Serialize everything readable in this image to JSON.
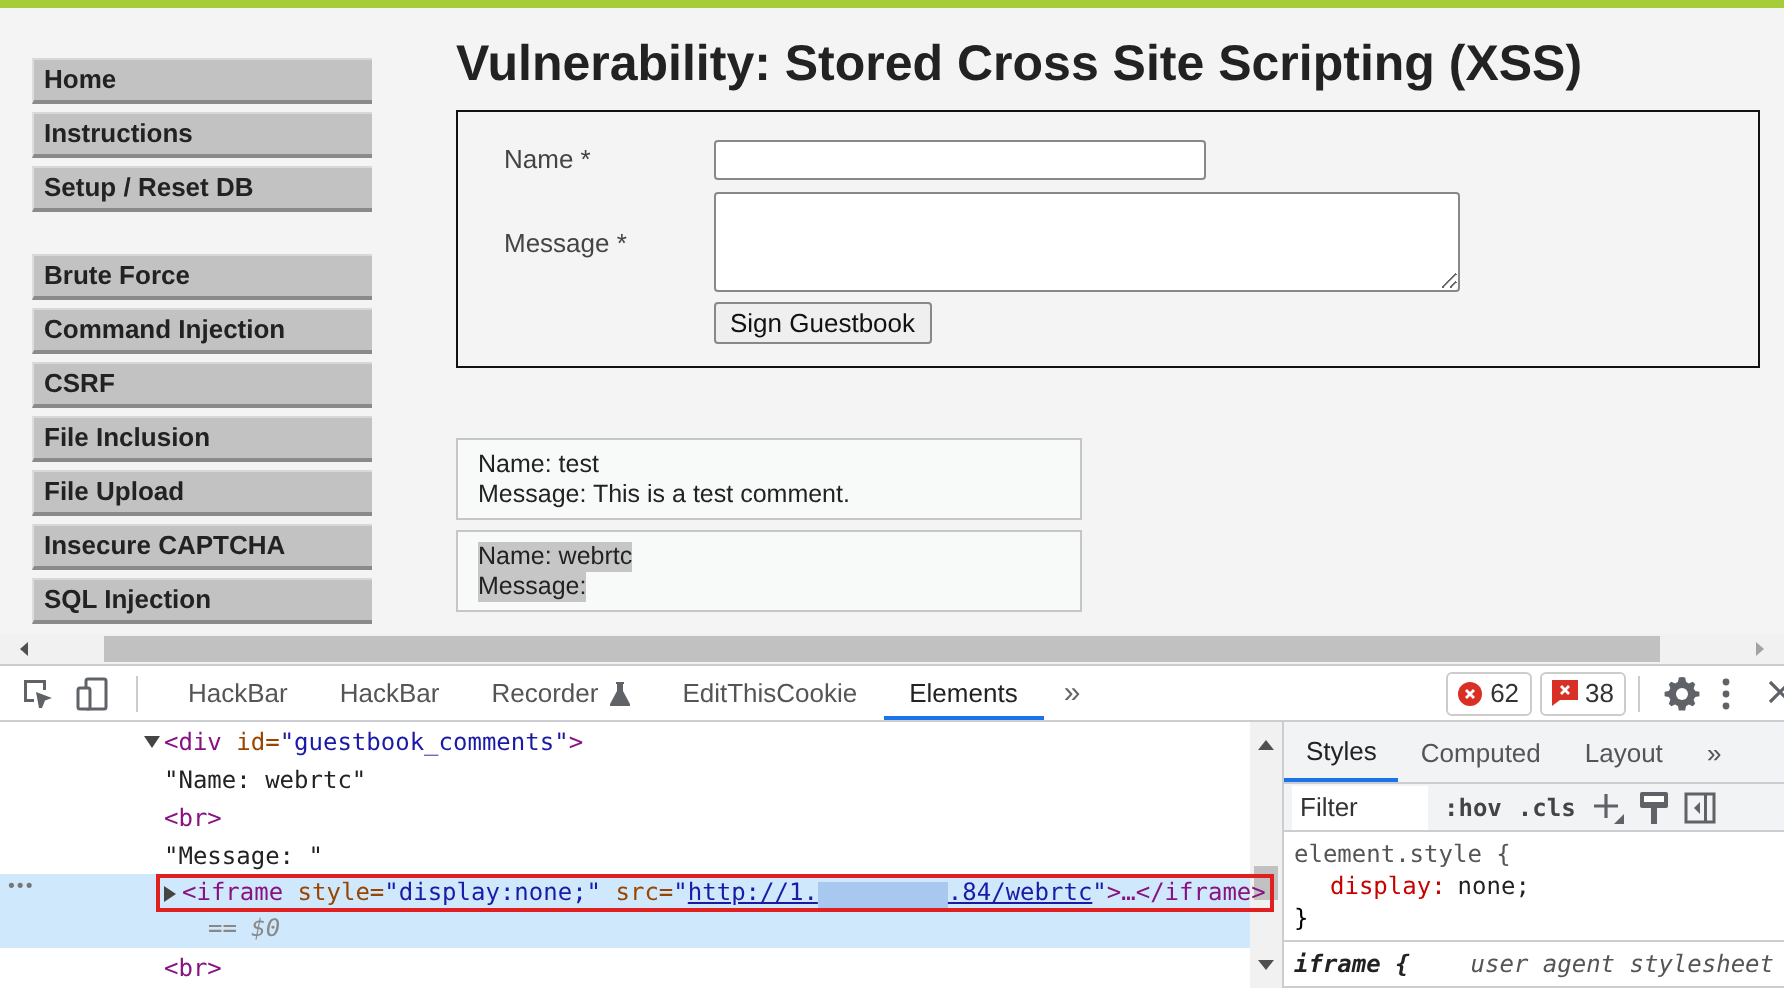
{
  "page": {
    "title": "Vulnerability: Stored Cross Site Scripting (XSS)",
    "sidebar": {
      "groups": [
        [
          "Home",
          "Instructions",
          "Setup / Reset DB"
        ],
        [
          "Brute Force",
          "Command Injection",
          "CSRF",
          "File Inclusion",
          "File Upload",
          "Insecure CAPTCHA",
          "SQL Injection"
        ]
      ]
    },
    "form": {
      "fields": [
        {
          "label": "Name *",
          "kind": "input"
        },
        {
          "label": "Message *",
          "kind": "textarea"
        }
      ],
      "button": "Sign Guestbook"
    },
    "comments": [
      {
        "name": "Name: test",
        "message": "Message: This is a test comment.",
        "selected": false
      },
      {
        "name": "Name: webrtc",
        "message": "Message:",
        "selected": true
      }
    ]
  },
  "devtools": {
    "tabs": [
      {
        "label": "HackBar",
        "selected": false,
        "kind": "plain"
      },
      {
        "label": "HackBar",
        "selected": false,
        "kind": "plain"
      },
      {
        "label": "Recorder",
        "selected": false,
        "kind": "experimental"
      },
      {
        "label": "EditThisCookie",
        "selected": false,
        "kind": "plain"
      },
      {
        "label": "Elements",
        "selected": true,
        "kind": "plain"
      }
    ],
    "more_tabs": "»",
    "errors": "62",
    "issues": "38",
    "dom_lines": [
      {
        "expanded": true,
        "selected": false,
        "tokens": [
          {
            "kind": "tag",
            "text": "<div"
          },
          {
            "kind": "attr",
            "text": " id="
          },
          {
            "kind": "value",
            "text": "\"guestbook_comments\""
          },
          {
            "kind": "tag",
            "text": ">"
          }
        ]
      },
      {
        "selected": false,
        "tokens": [
          {
            "kind": "text",
            "text": "\"Name: webrtc\""
          }
        ]
      },
      {
        "selected": false,
        "tokens": [
          {
            "kind": "tag",
            "text": "<br>"
          }
        ]
      },
      {
        "selected": false,
        "tokens": [
          {
            "kind": "text",
            "text": "\"Message: \""
          }
        ]
      },
      {
        "expanded": false,
        "selected": true,
        "gutter": "•••",
        "note": "== $0",
        "tokens": [
          {
            "kind": "tag",
            "text": "<iframe"
          },
          {
            "kind": "attr",
            "text": " style="
          },
          {
            "kind": "value",
            "text": "\"display:none;\""
          },
          {
            "kind": "attr",
            "text": " src="
          },
          {
            "kind": "value",
            "text": "\""
          },
          {
            "kind": "link",
            "text": "http://1."
          },
          {
            "kind": "redaction"
          },
          {
            "kind": "link",
            "text": ".84/webrtc"
          },
          {
            "kind": "value",
            "text": "\""
          },
          {
            "kind": "tag",
            "text": ">…</iframe>"
          }
        ]
      },
      {
        "selected": false,
        "tokens": [
          {
            "kind": "tag",
            "text": "<br>"
          }
        ]
      }
    ],
    "styles": {
      "tabs": [
        {
          "label": "Styles",
          "selected": true
        },
        {
          "label": "Computed",
          "selected": false
        },
        {
          "label": "Layout",
          "selected": false
        }
      ],
      "more_tabs": "»",
      "filter_placeholder": "Filter",
      "hov": ":hov",
      "cls": ".cls",
      "rules": [
        {
          "selector": "element.style {",
          "props": [
            {
              "name": "display:",
              "value": "none;"
            }
          ],
          "close": "}"
        },
        {
          "selector": "iframe {",
          "origin": "user agent stylesheet"
        }
      ]
    }
  }
}
